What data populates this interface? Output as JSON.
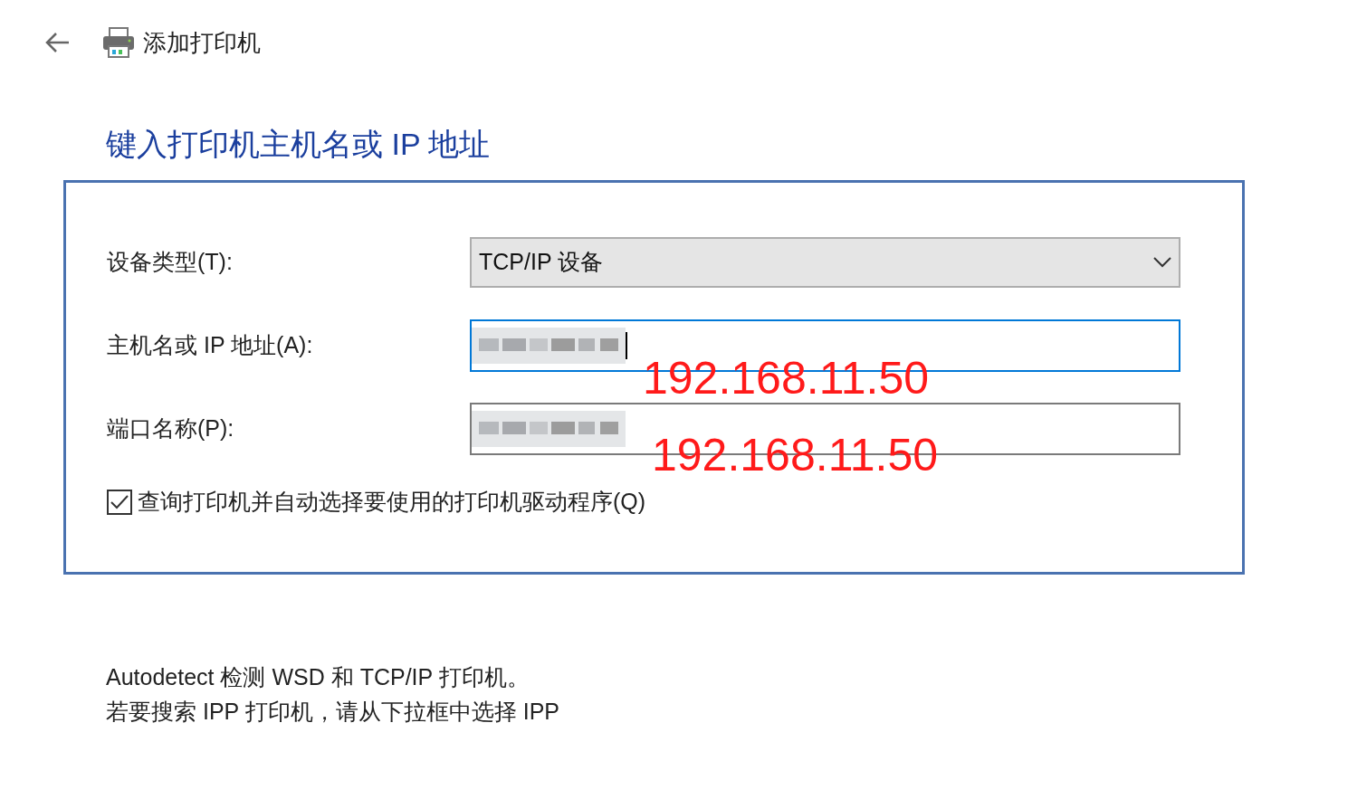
{
  "header": {
    "title": "添加打印机"
  },
  "heading": "键入打印机主机名或 IP 地址",
  "form": {
    "fields": [
      {
        "kind": "dropdown",
        "label": "设备类型(T):",
        "value": "TCP/IP 设备"
      },
      {
        "kind": "text",
        "label": "主机名或 IP 地址(A):",
        "redacted": true,
        "focused": true,
        "annotation": "192.168.11.50"
      },
      {
        "kind": "text",
        "label": "端口名称(P):",
        "redacted": true,
        "focused": false,
        "annotation": "192.168.11.50"
      }
    ],
    "checkbox": {
      "label": "查询打印机并自动选择要使用的打印机驱动程序(Q)",
      "checked": true
    }
  },
  "notes": [
    "Autodetect 检测 WSD 和 TCP/IP 打印机。",
    "若要搜索 IPP 打印机，请从下拉框中选择 IPP"
  ]
}
